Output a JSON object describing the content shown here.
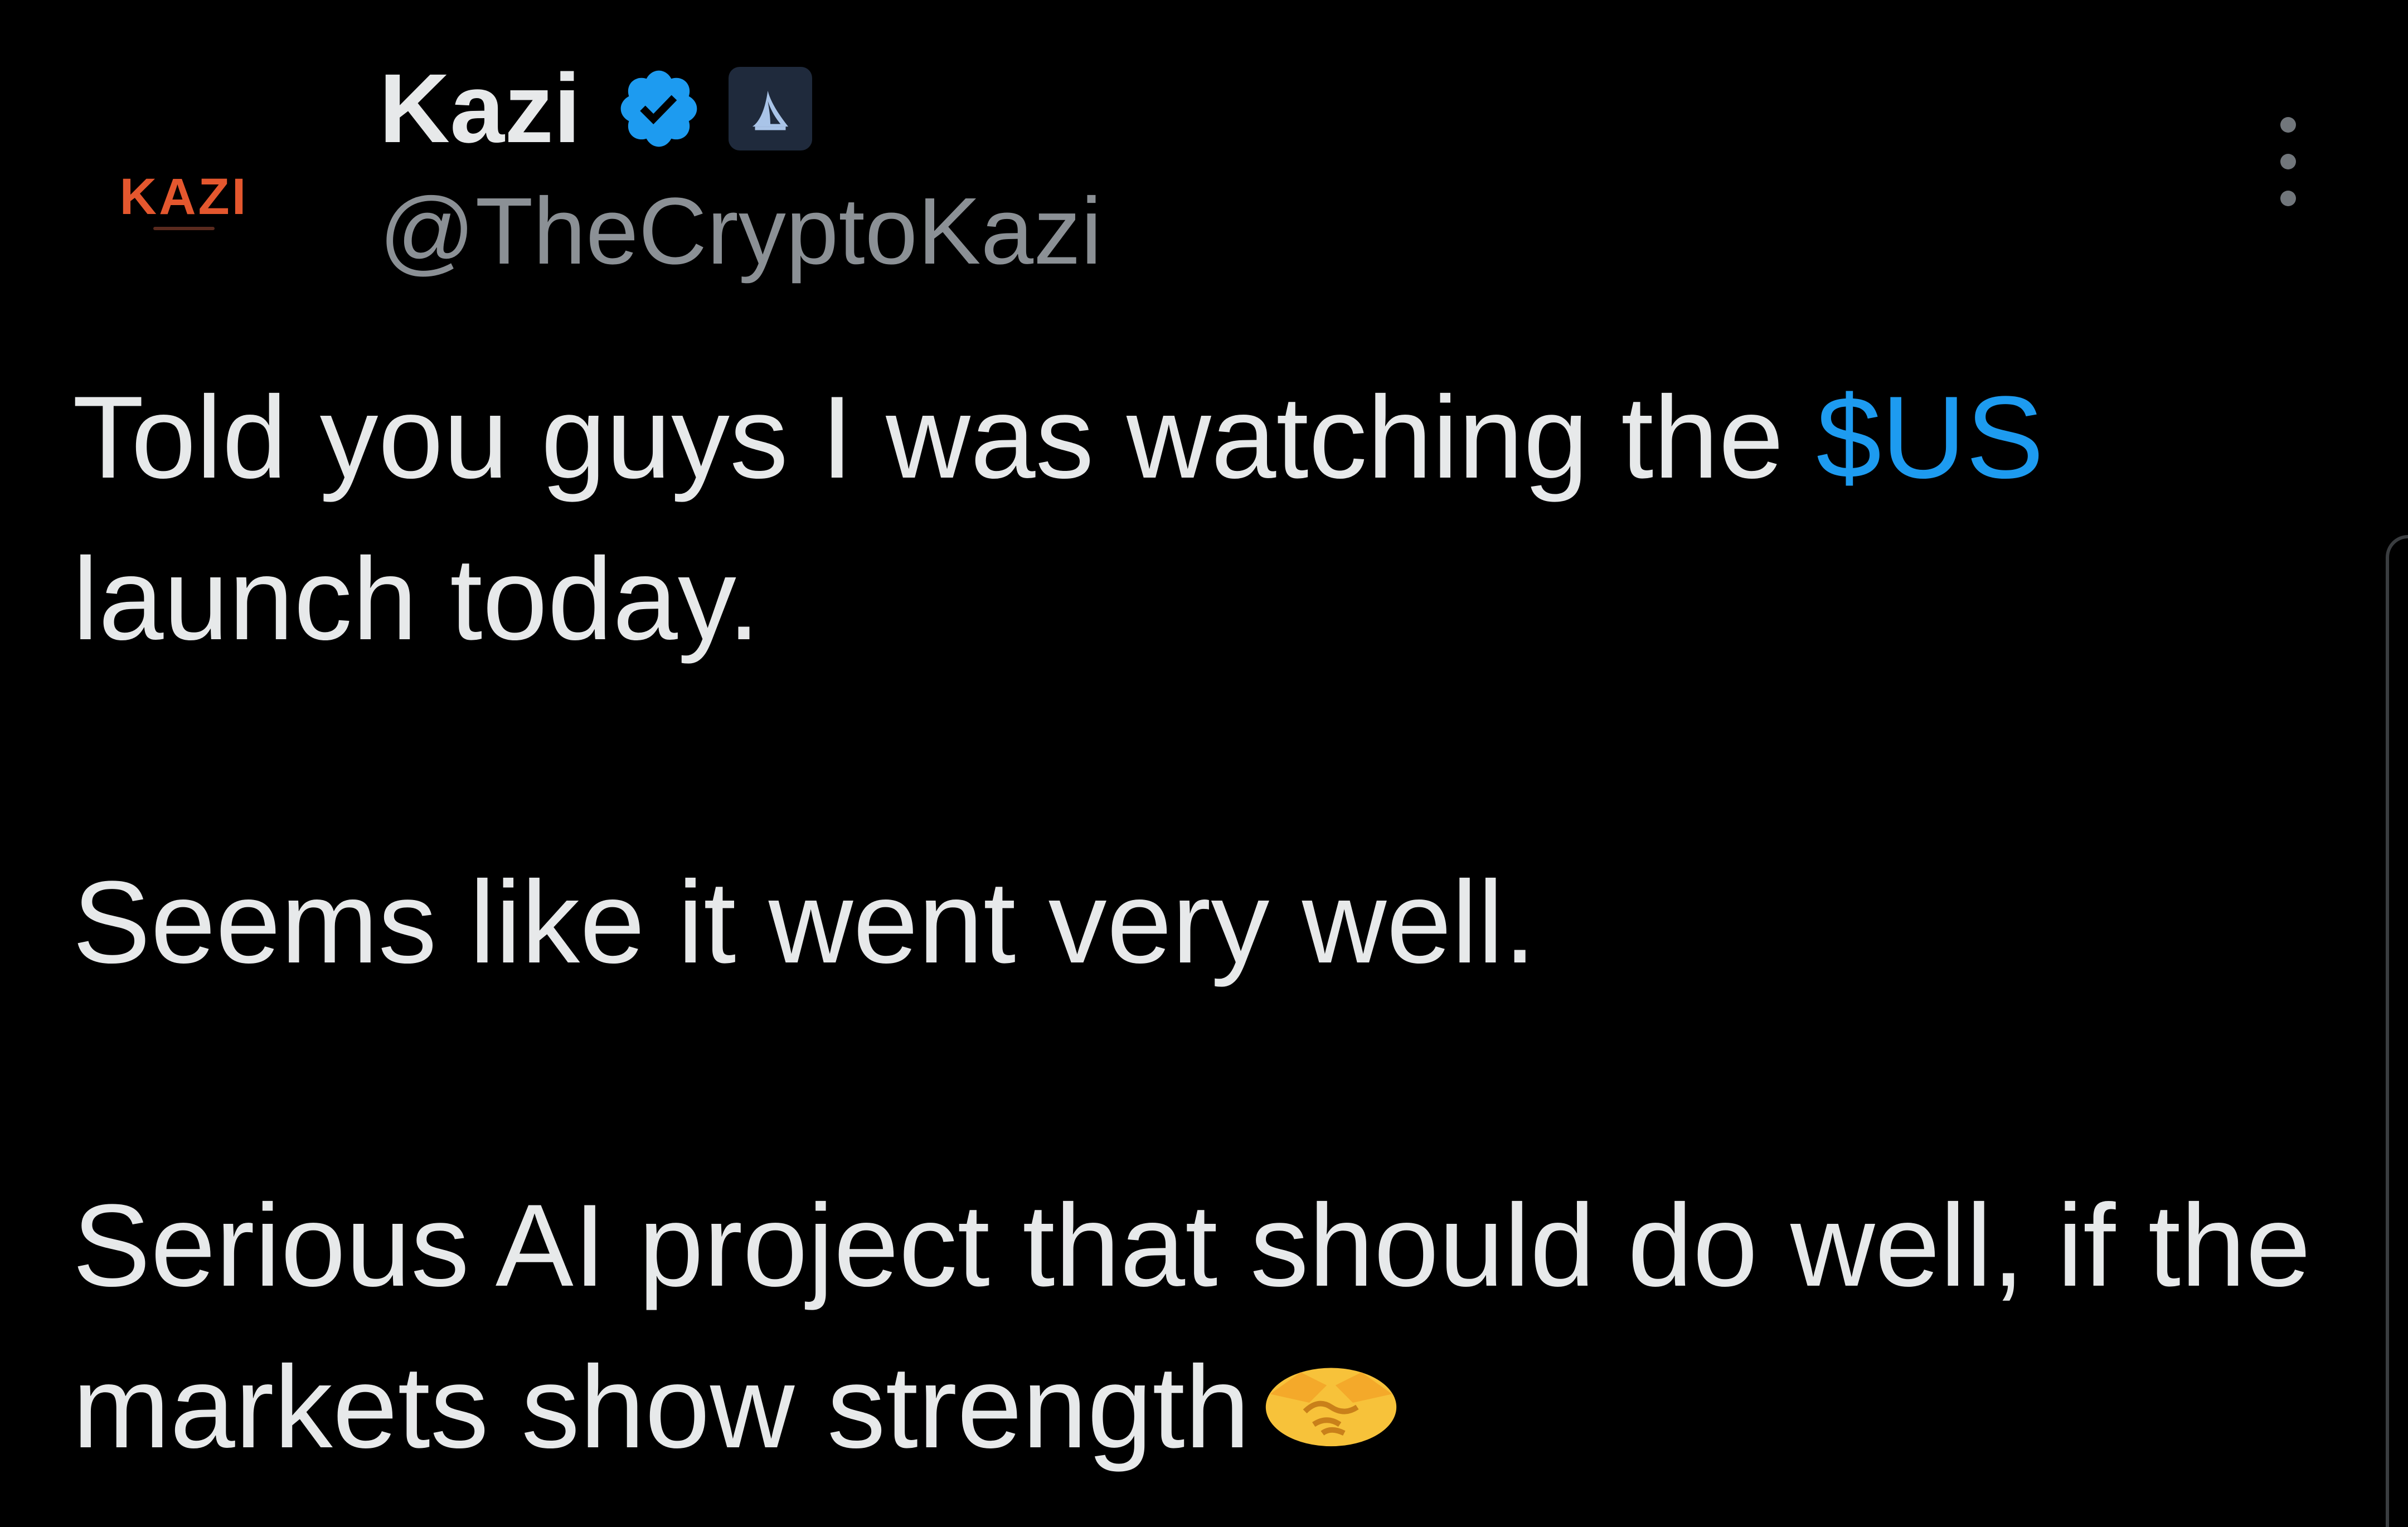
{
  "author": {
    "avatar_text": "KAZI",
    "display_name": "Kazi",
    "handle": "@TheCryptoKazi",
    "verified": true,
    "affiliate_badge_icon": "shark-fin-icon"
  },
  "tweet": {
    "line1_prefix": "Told you guys I was watching the ",
    "cashtag": "$US",
    "line1_suffix": "launch today.",
    "para2": "Seems like it went very well.",
    "para3": "Serious AI project that should do well, if the markets show strength",
    "emoji_icon": "handshake-icon"
  },
  "colors": {
    "background": "#000000",
    "text": "#e7e9ea",
    "secondary_text": "#8b9095",
    "link": "#1d9bf0",
    "verified": "#1d9bf0",
    "avatar_brand": "#e4572e"
  }
}
